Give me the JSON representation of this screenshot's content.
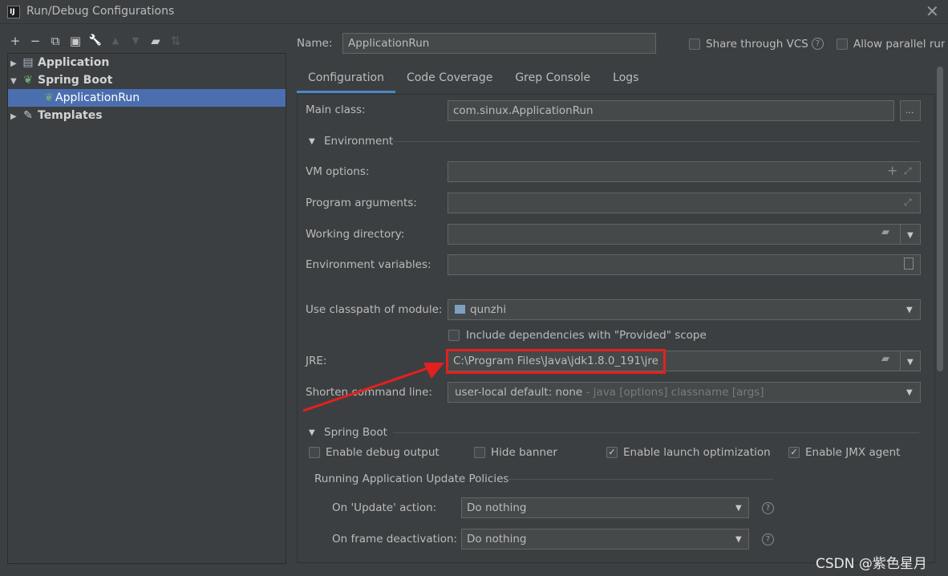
{
  "window": {
    "title": "Run/Debug Configurations",
    "close_glyph": "✕",
    "app_icon_text": "IJ"
  },
  "toolbar": {
    "buttons": [
      {
        "name": "add-icon",
        "glyph": "+",
        "enabled": true
      },
      {
        "name": "remove-icon",
        "glyph": "−",
        "enabled": true
      },
      {
        "name": "copy-icon",
        "glyph": "⧉",
        "enabled": true
      },
      {
        "name": "save-icon",
        "glyph": "▣",
        "enabled": true
      },
      {
        "name": "wrench-icon",
        "glyph": "🔧",
        "enabled": true
      },
      {
        "name": "move-up-icon",
        "glyph": "▲",
        "enabled": false
      },
      {
        "name": "move-down-icon",
        "glyph": "▼",
        "enabled": false
      },
      {
        "name": "folder-add-icon",
        "glyph": "▰",
        "enabled": true
      },
      {
        "name": "sort-icon",
        "glyph": "⇅",
        "enabled": false
      }
    ]
  },
  "tree": {
    "application": "Application",
    "spring_boot": "Spring Boot",
    "application_run": "ApplicationRun",
    "templates": "Templates"
  },
  "header": {
    "name_label": "Name:",
    "name_value": "ApplicationRun",
    "share_vcs": "Share through VCS",
    "allow_parallel": "Allow parallel run"
  },
  "tabs": [
    "Configuration",
    "Code Coverage",
    "Grep Console",
    "Logs"
  ],
  "config": {
    "main_class_label": "Main class:",
    "main_class_value": "com.sinux.ApplicationRun",
    "browse_button": "...",
    "environment_section": "Environment",
    "vm_options_label": "VM options:",
    "program_args_label": "Program arguments:",
    "working_dir_label": "Working directory:",
    "env_vars_label": "Environment variables:",
    "classpath_label": "Use classpath of module:",
    "classpath_value": "qunzhi",
    "include_deps": "Include dependencies with \"Provided\" scope",
    "jre_label": "JRE:",
    "jre_value": "C:\\Program Files\\Java\\jdk1.8.0_191\\jre",
    "shorten_label": "Shorten command line:",
    "shorten_value": "user-local default: none",
    "shorten_hint": " - java [options] classname [args]",
    "spring_boot_section": "Spring Boot",
    "enable_debug": "Enable debug output",
    "hide_banner": "Hide banner",
    "enable_launch_opt": "Enable launch optimization",
    "enable_jmx": "Enable JMX agent",
    "running_policies": "Running Application Update Policies",
    "on_update_label": "On 'Update' action:",
    "on_update_value": "Do nothing",
    "on_frame_label": "On frame deactivation:",
    "on_frame_value": "Do nothing"
  },
  "checkbox_state": {
    "share_vcs": false,
    "allow_parallel": false,
    "include_deps": false,
    "enable_debug": false,
    "hide_banner": false,
    "enable_launch_opt": true,
    "enable_jmx": true
  },
  "watermark": "CSDN @紫色星月",
  "colors": {
    "selection": "#4b6eaf",
    "tab_underline": "#4a88c7",
    "annotation_red": "#e3201f"
  }
}
